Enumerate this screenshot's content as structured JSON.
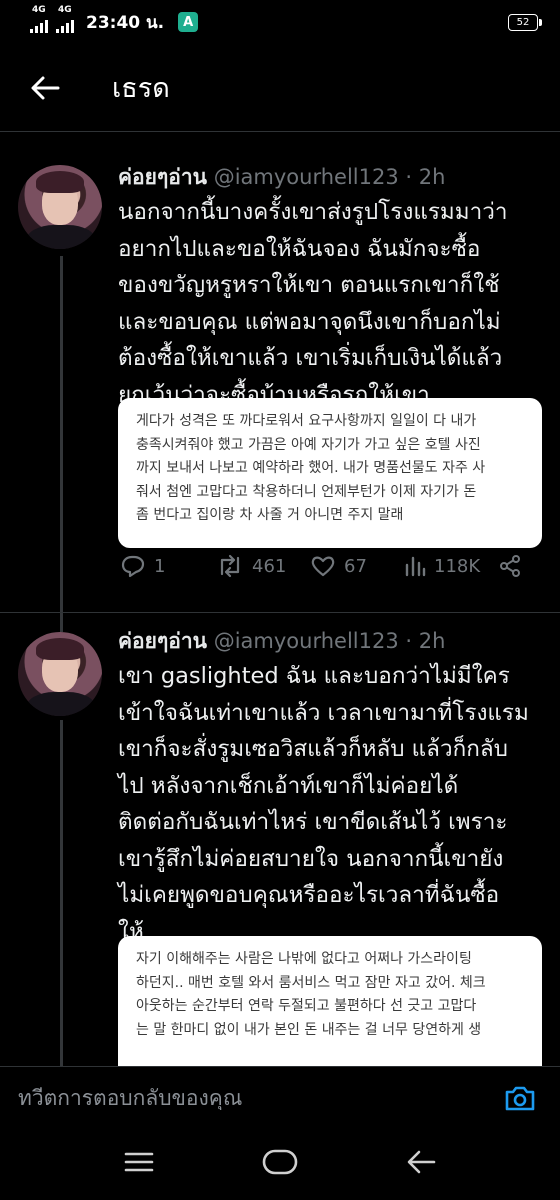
{
  "status_bar": {
    "signal1": "4G",
    "signal2": "4G",
    "time": "23:40 น.",
    "app_badge": "A",
    "battery": "52"
  },
  "header": {
    "title": "เธรด",
    "back_icon": "arrow-left-icon"
  },
  "tweets": [
    {
      "name": "ค่อยๆอ่าน",
      "handle": "@iamyourhell123",
      "dot": "·",
      "time": "2h",
      "lines": [
        "นอกจากนี้บางครั้งเขาส่งรูปโรงแรมมาว่า",
        "อยากไปและขอให้ฉันจอง ฉันมักจะซื้อ",
        "ของขวัญหรูหราให้เขา ตอนแรกเขาก็ใช้",
        "และขอบคุณ แต่พอมาจุดนึงเขาก็บอกไม่",
        "ต้องซื้อให้เขาแล้ว เขาเริ่มเก็บเงินได้แล้ว",
        "ยกเว้นว่าจะซื้อบ้านหรือรถให้เขา"
      ],
      "quote_lines": [
        "게다가 성격은 또 까다로워서 요구사항까지 일일이 다 내가",
        "충족시켜줘야 했고 가끔은 아예 자기가 가고 싶은 호텔 사진",
        "까지 보내서 나보고 예약하라 했어. 내가 명품선물도 자주 사",
        "줘서 첨엔 고맙다고 착용하더니 언제부턴가 이제 자기가 돈",
        "좀 번다고 집이랑 차 사줄 거 아니면 주지 말래"
      ],
      "replies": "1",
      "retweets": "461",
      "likes": "67",
      "views": "118K"
    },
    {
      "name": "ค่อยๆอ่าน",
      "handle": "@iamyourhell123",
      "dot": "·",
      "time": "2h",
      "lines": [
        "เขา gaslighted ฉัน และบอกว่าไม่มีใคร",
        "เข้าใจฉันเท่าเขาแล้ว เวลาเขามาที่โรงแรม",
        "เขาก็จะสั่งรูมเซอวิสแล้วก็หลับ แล้วก็กลับ",
        "ไป หลังจากเช็กเอ้าท์เขาก็ไม่ค่อยได้",
        "ติดต่อกับฉันเท่าไหร่ เขาขีดเส้นไว้ เพราะ",
        "เขารู้สึกไม่ค่อยสบายใจ นอกจากนี้เขายัง",
        "ไม่เคยพูดขอบคุณหรืออะไรเวลาที่ฉันซื้อ",
        "ให้"
      ],
      "quote_lines": [
        "자기 이해해주는 사람은 나밖에 없다고 어쩌나 가스라이팅",
        "하던지.. 매번 호텔 와서 룸서비스 먹고 잠만 자고 갔어. 체크",
        "아웃하는 순간부터 연락 두절되고 불편하다 선 긋고 고맙다",
        "는 말 한마디 없이 내가 본인 돈 내주는 걸 너무 당연하게 생"
      ]
    }
  ],
  "compose": {
    "placeholder": "ทวีตการตอบกลับของคุณ",
    "camera_icon": "camera-icon"
  },
  "nav": [
    "menu-icon",
    "home-icon",
    "back-icon"
  ]
}
